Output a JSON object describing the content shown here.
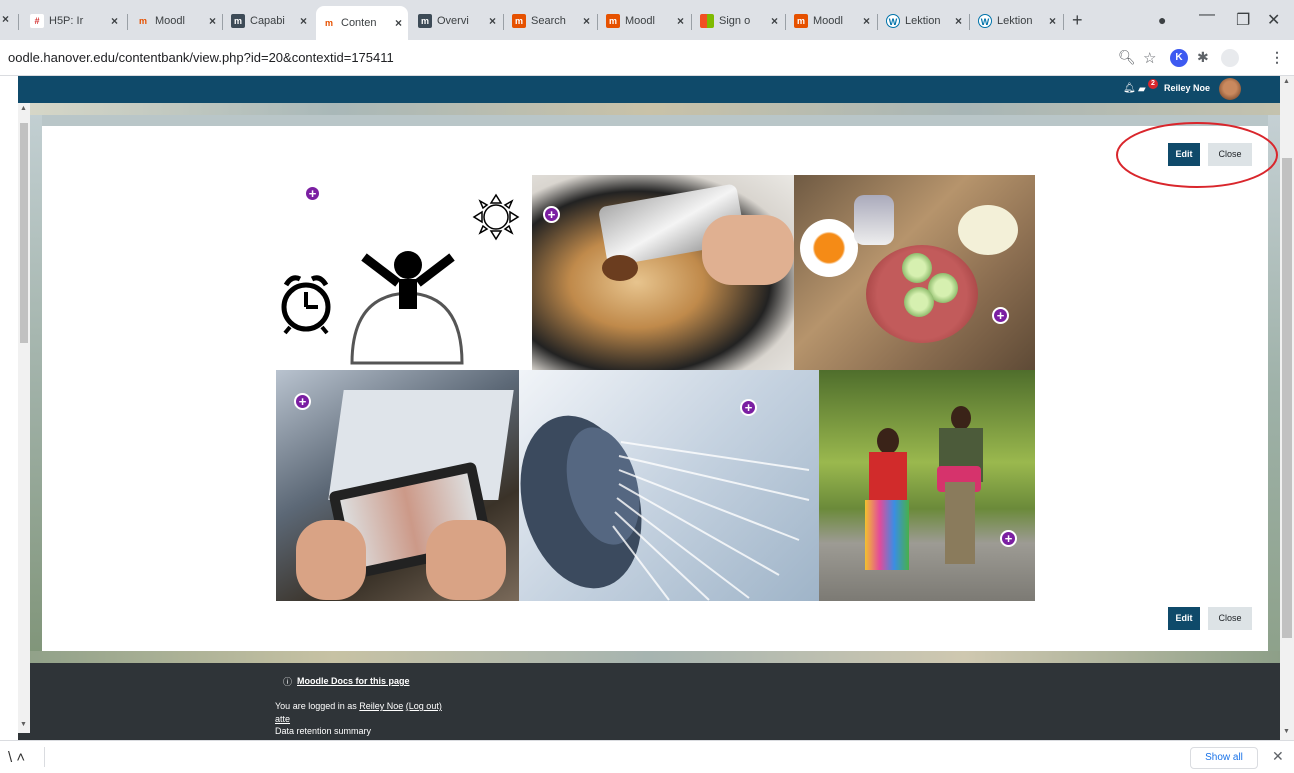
{
  "browser": {
    "tabs": [
      {
        "label": "H5P: Ir",
        "favicon": "h5p"
      },
      {
        "label": "Moodl",
        "favicon": "moodle"
      },
      {
        "label": "Capabi",
        "favicon": "moodle-m"
      },
      {
        "label": "Conten",
        "favicon": "moodle",
        "active": true
      },
      {
        "label": "Overvi",
        "favicon": "moodle-m"
      },
      {
        "label": "Search",
        "favicon": "moodle-m"
      },
      {
        "label": "Moodl",
        "favicon": "moodle-m"
      },
      {
        "label": "Sign o",
        "favicon": "microsoft"
      },
      {
        "label": "Moodl",
        "favicon": "moodle-m"
      },
      {
        "label": "Lektion",
        "favicon": "wordpress"
      },
      {
        "label": "Lektion",
        "favicon": "wordpress"
      }
    ],
    "url": "oodle.hanover.edu/contentbank/view.php?id=20&contextid=175411",
    "profile_initial": "K"
  },
  "navbar": {
    "user_name": "Reiley Noe",
    "notification_count": "2"
  },
  "content": {
    "edit_label": "Edit",
    "close_label": "Close",
    "plus_glyph": "+"
  },
  "footer": {
    "docs_link": "Moodle Docs for this page",
    "logged_in_prefix": "You are logged in as",
    "user_link": "Reiley Noe",
    "logout_link": "(Log out)",
    "line2": "atte",
    "data_retention": "Data retention summary"
  },
  "download_bar": {
    "show_all": "Show all"
  },
  "colors": {
    "navbar": "#0f4a6a",
    "edit_button": "#0f4a6a",
    "hotspot": "#7b1fa2",
    "annotation_circle": "#d9262c"
  }
}
